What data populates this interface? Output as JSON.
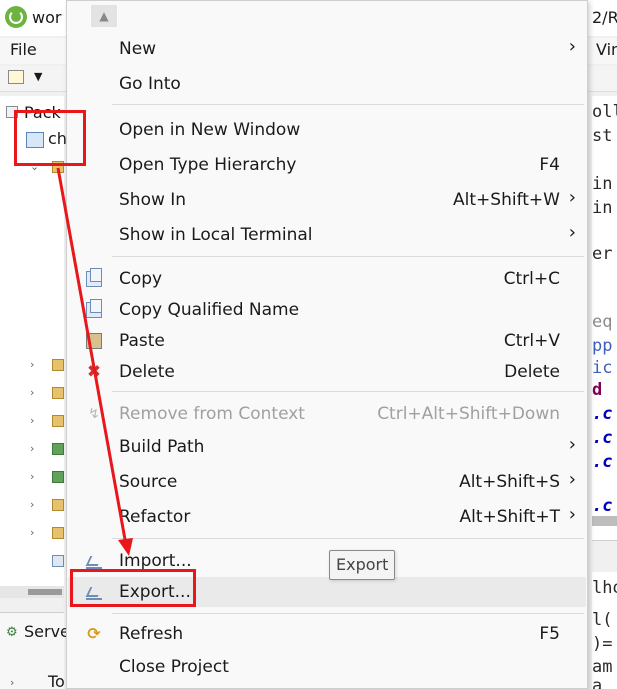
{
  "window": {
    "title_left": "wor",
    "title_right": "2/R"
  },
  "menubar": {
    "file": "File",
    "right_fragment": "Vin"
  },
  "explorer": {
    "tab_label": "Pack",
    "project_label": "ch",
    "servers_label": "Serve",
    "bottom_item": "To"
  },
  "editor_fragments": [
    "olle",
    "st",
    "",
    "in",
    "in",
    "",
    "er",
    "",
    "",
    "eq",
    "pp",
    "ic",
    "d",
    ".c",
    ".c",
    ".c",
    "",
    ".c"
  ],
  "editor_lower_fragments": [
    "lho",
    "l(",
    ")=",
    "am",
    "a"
  ],
  "context_menu": {
    "items": [
      {
        "label": "New",
        "shortcut": "",
        "submenu": true,
        "icon": ""
      },
      {
        "label": "Go Into",
        "shortcut": "",
        "submenu": false,
        "icon": ""
      },
      {
        "label": "Open in New Window",
        "shortcut": "",
        "submenu": false,
        "icon": ""
      },
      {
        "label": "Open Type Hierarchy",
        "shortcut": "F4",
        "submenu": false,
        "icon": ""
      },
      {
        "label": "Show In",
        "shortcut": "Alt+Shift+W",
        "submenu": true,
        "icon": ""
      },
      {
        "label": "Show in Local Terminal",
        "shortcut": "",
        "submenu": true,
        "icon": ""
      },
      {
        "label": "Copy",
        "shortcut": "Ctrl+C",
        "submenu": false,
        "icon": "copy-icon"
      },
      {
        "label": "Copy Qualified Name",
        "shortcut": "",
        "submenu": false,
        "icon": "copy-qualified-name-icon"
      },
      {
        "label": "Paste",
        "shortcut": "Ctrl+V",
        "submenu": false,
        "icon": "paste-icon"
      },
      {
        "label": "Delete",
        "shortcut": "Delete",
        "submenu": false,
        "icon": "delete-icon"
      },
      {
        "label": "Remove from Context",
        "shortcut": "Ctrl+Alt+Shift+Down",
        "submenu": false,
        "icon": "remove-from-context-icon",
        "disabled": true
      },
      {
        "label": "Build Path",
        "shortcut": "",
        "submenu": true,
        "icon": ""
      },
      {
        "label": "Source",
        "shortcut": "Alt+Shift+S",
        "submenu": true,
        "icon": ""
      },
      {
        "label": "Refactor",
        "shortcut": "Alt+Shift+T",
        "submenu": true,
        "icon": ""
      },
      {
        "label": "Import...",
        "shortcut": "",
        "submenu": false,
        "icon": "import-icon"
      },
      {
        "label": "Export...",
        "shortcut": "",
        "submenu": false,
        "icon": "export-icon",
        "hovered": true
      },
      {
        "label": "Refresh",
        "shortcut": "F5",
        "submenu": false,
        "icon": "refresh-icon"
      },
      {
        "label": "Close Project",
        "shortcut": "",
        "submenu": false,
        "icon": ""
      }
    ],
    "submenu_glyph": "›",
    "scroll_up_glyph": "▲"
  },
  "tooltip": {
    "text": "Export"
  },
  "colors": {
    "annotation": "#e8171b",
    "menu_bg": "#f9f9f9",
    "hover_bg": "#eaeaea",
    "disabled_text": "#a0a0a0"
  },
  "icons": {
    "copy-icon": "❐",
    "paste-icon": "📋",
    "delete-icon": "✖",
    "refresh-icon": "⟳",
    "remove-from-context-icon": "↯"
  }
}
